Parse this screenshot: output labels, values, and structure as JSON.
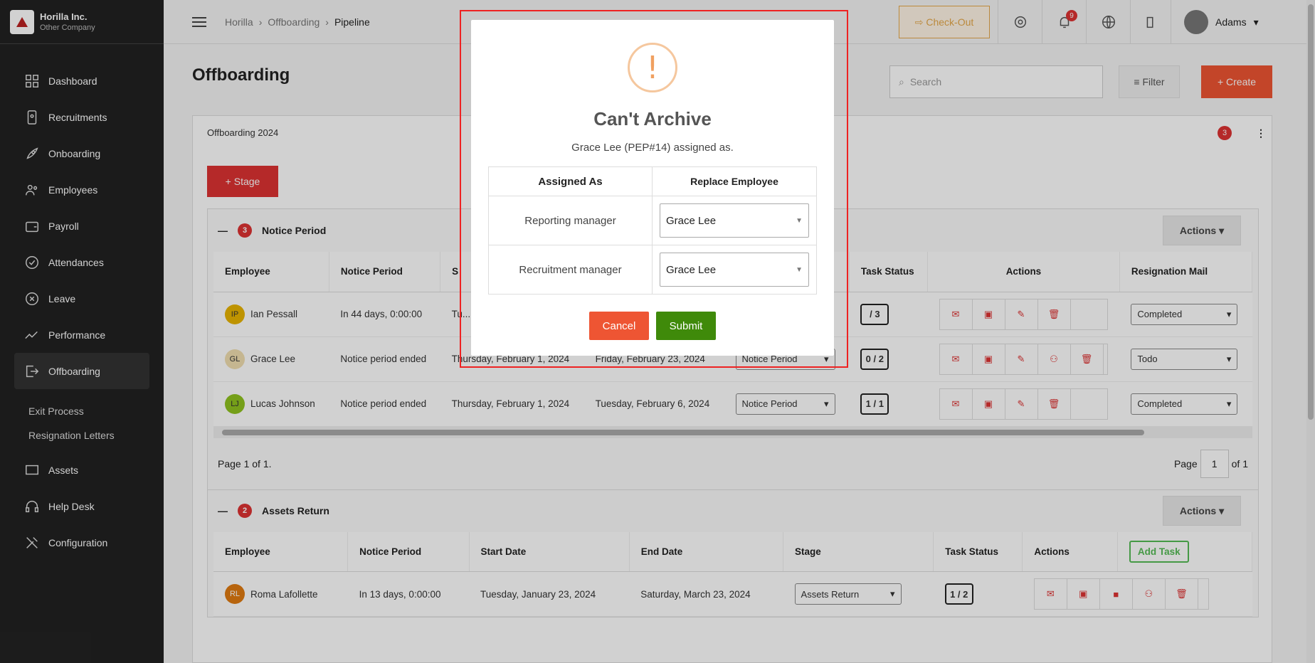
{
  "brand": {
    "name": "Horilla Inc.",
    "company": "Other Company"
  },
  "sidebar": {
    "items": [
      {
        "label": "Dashboard",
        "icon": "dashboard-icon"
      },
      {
        "label": "Recruitments",
        "icon": "recruitment-icon"
      },
      {
        "label": "Onboarding",
        "icon": "rocket-icon"
      },
      {
        "label": "Employees",
        "icon": "users-icon"
      },
      {
        "label": "Payroll",
        "icon": "wallet-icon"
      },
      {
        "label": "Attendances",
        "icon": "check-circle-icon"
      },
      {
        "label": "Leave",
        "icon": "x-circle-icon"
      },
      {
        "label": "Performance",
        "icon": "trend-icon"
      },
      {
        "label": "Offboarding",
        "icon": "exit-icon"
      }
    ],
    "submenu": [
      "Exit Process",
      "Resignation Letters"
    ],
    "items_after": [
      {
        "label": "Assets",
        "icon": "laptop-icon"
      },
      {
        "label": "Help Desk",
        "icon": "headset-icon"
      },
      {
        "label": "Configuration",
        "icon": "tools-icon"
      }
    ]
  },
  "topbar": {
    "breadcrumb": [
      "Horilla",
      "Offboarding",
      "Pipeline"
    ],
    "checkout_label": "Check-Out",
    "notification_count": "9",
    "user_name": "Adams"
  },
  "page": {
    "title": "Offboarding",
    "search_placeholder": "Search",
    "filter_label": "Filter",
    "create_label": "+ Create"
  },
  "card": {
    "title": "Offboarding 2024",
    "badge": "3",
    "stage_button": "+ Stage"
  },
  "stage1": {
    "count": "3",
    "name": "Notice Period",
    "actions_label": "Actions",
    "columns": [
      "Employee",
      "Notice Period",
      "S",
      "",
      "",
      "Task Status",
      "Actions",
      "Resignation Mail"
    ],
    "rows": [
      {
        "initials": "IP",
        "name": "Ian Pessall",
        "notice": "In 44 days, 0:00:00",
        "start": "Tu... 202...",
        "end": "",
        "stage": "",
        "task": "/ 3",
        "mail": "Completed",
        "color": "#e8b400"
      },
      {
        "initials": "GL",
        "name": "Grace Lee",
        "notice": "Notice period ended",
        "start": "Thursday, February 1, 2024",
        "end": "Friday, February 23, 2024",
        "stage": "Notice Period",
        "task": "0 / 2",
        "mail": "Todo",
        "color": "#f1dfb0"
      },
      {
        "initials": "LJ",
        "name": "Lucas Johnson",
        "notice": "Notice period ended",
        "start": "Thursday, February 1, 2024",
        "end": "Tuesday, February 6, 2024",
        "stage": "Notice Period",
        "task": "1 / 1",
        "mail": "Completed",
        "color": "#8fc31f"
      }
    ],
    "page_text": "Page 1 of 1.",
    "page_label": "Page",
    "page_value": "1",
    "page_of": "of 1"
  },
  "stage2": {
    "count": "2",
    "name": "Assets Return",
    "actions_label": "Actions",
    "columns": [
      "Employee",
      "Notice Period",
      "Start Date",
      "End Date",
      "Stage",
      "Task Status",
      "Actions"
    ],
    "add_task": "Add Task",
    "rows": [
      {
        "initials": "RL",
        "name": "Roma Lafollette",
        "notice": "In 13 days, 0:00:00",
        "start": "Tuesday, January 23, 2024",
        "end": "Saturday, March 23, 2024",
        "stage": "Assets Return",
        "task": "1 / 2",
        "color": "#e07a10"
      }
    ]
  },
  "modal": {
    "title": "Can't Archive",
    "subtitle": "Grace Lee (PEP#14) assigned as.",
    "col1": "Assigned As",
    "col2": "Replace Employee",
    "rows": [
      {
        "role": "Reporting manager",
        "value": "Grace Lee"
      },
      {
        "role": "Recruitment manager",
        "value": "Grace Lee"
      }
    ],
    "cancel_label": "Cancel",
    "submit_label": "Submit"
  }
}
